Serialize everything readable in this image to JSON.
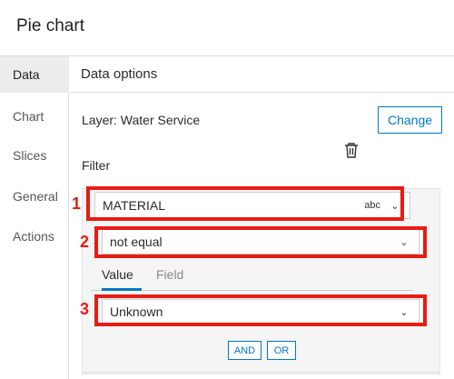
{
  "panel": {
    "title": "Pie chart"
  },
  "sidebar": {
    "items": [
      {
        "label": "Data",
        "active": true
      },
      {
        "label": "Chart",
        "active": false
      },
      {
        "label": "Slices",
        "active": false
      },
      {
        "label": "General",
        "active": false
      },
      {
        "label": "Actions",
        "active": false
      }
    ]
  },
  "data_options": {
    "heading": "Data options",
    "layer_label": "Layer: Water Service",
    "change_label": "Change",
    "filter_label": "Filter"
  },
  "filter": {
    "field_value": "MATERIAL",
    "field_type": "abc",
    "operator_value": "not equal",
    "tabs": [
      "Value",
      "Field"
    ],
    "active_tab": "Value",
    "value_value": "Unknown",
    "and_label": "AND",
    "or_label": "OR"
  },
  "annotations": {
    "callouts": [
      "1",
      "2",
      "3"
    ],
    "color": "#e81b14"
  },
  "colors": {
    "accent": "#0079c1",
    "highlight": "#e81b14",
    "active_nav_bg": "#ececec"
  }
}
